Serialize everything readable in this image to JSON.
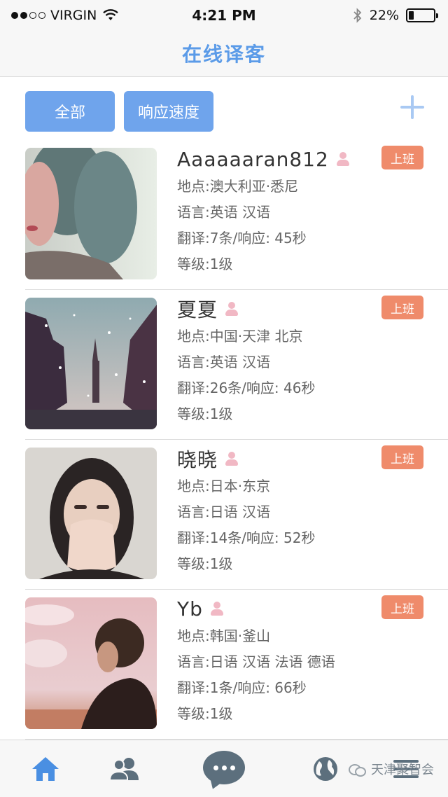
{
  "status_bar": {
    "carrier": "VIRGIN",
    "time": "4:21 PM",
    "battery": "22%",
    "battery_level": 0.22,
    "signal_bars_filled": 2,
    "signal_bars_total": 4,
    "icons": [
      "wifi-icon",
      "bluetooth-icon",
      "battery-icon"
    ]
  },
  "nav": {
    "title": "在线译客"
  },
  "filters": {
    "all_label": "全部",
    "speed_label": "响应速度",
    "add_icon": "plus-icon"
  },
  "translators": [
    {
      "name": "Aaaaaaran812",
      "status": "上班",
      "location": "地点:澳大利亚·悉尼",
      "languages": "语言:英语 汉语",
      "stats": "翻译:7条/响应: 45秒",
      "level": "等级:1级"
    },
    {
      "name": "夏夏",
      "status": "上班",
      "location": "地点:中国·天津 北京",
      "languages": "语言:英语 汉语",
      "stats": "翻译:26条/响应: 46秒",
      "level": "等级:1级"
    },
    {
      "name": "晓晓",
      "status": "上班",
      "location": "地点:日本·东京",
      "languages": "语言:日语 汉语",
      "stats": "翻译:14条/响应: 52秒",
      "level": "等级:1级"
    },
    {
      "name": "Yb",
      "status": "上班",
      "location": "地点:韩国·釜山",
      "languages": "语言:日语 汉语 法语 德语",
      "stats": "翻译:1条/响应: 66秒",
      "level": "等级:1级"
    }
  ],
  "tab_bar": {
    "tabs": [
      "home-icon",
      "contacts-icon",
      "chat-icon",
      "globe-icon",
      "menu-icon"
    ],
    "active": "home-icon"
  },
  "watermark": {
    "text": "天津聚智会"
  },
  "colors": {
    "accent": "#5b9be8",
    "button": "#6fa4ec",
    "badge": "#ef8b6b",
    "person_icon": "#f1b8c4",
    "tab_icon": "#5c6f7d",
    "tab_active": "#4a8fe2"
  }
}
